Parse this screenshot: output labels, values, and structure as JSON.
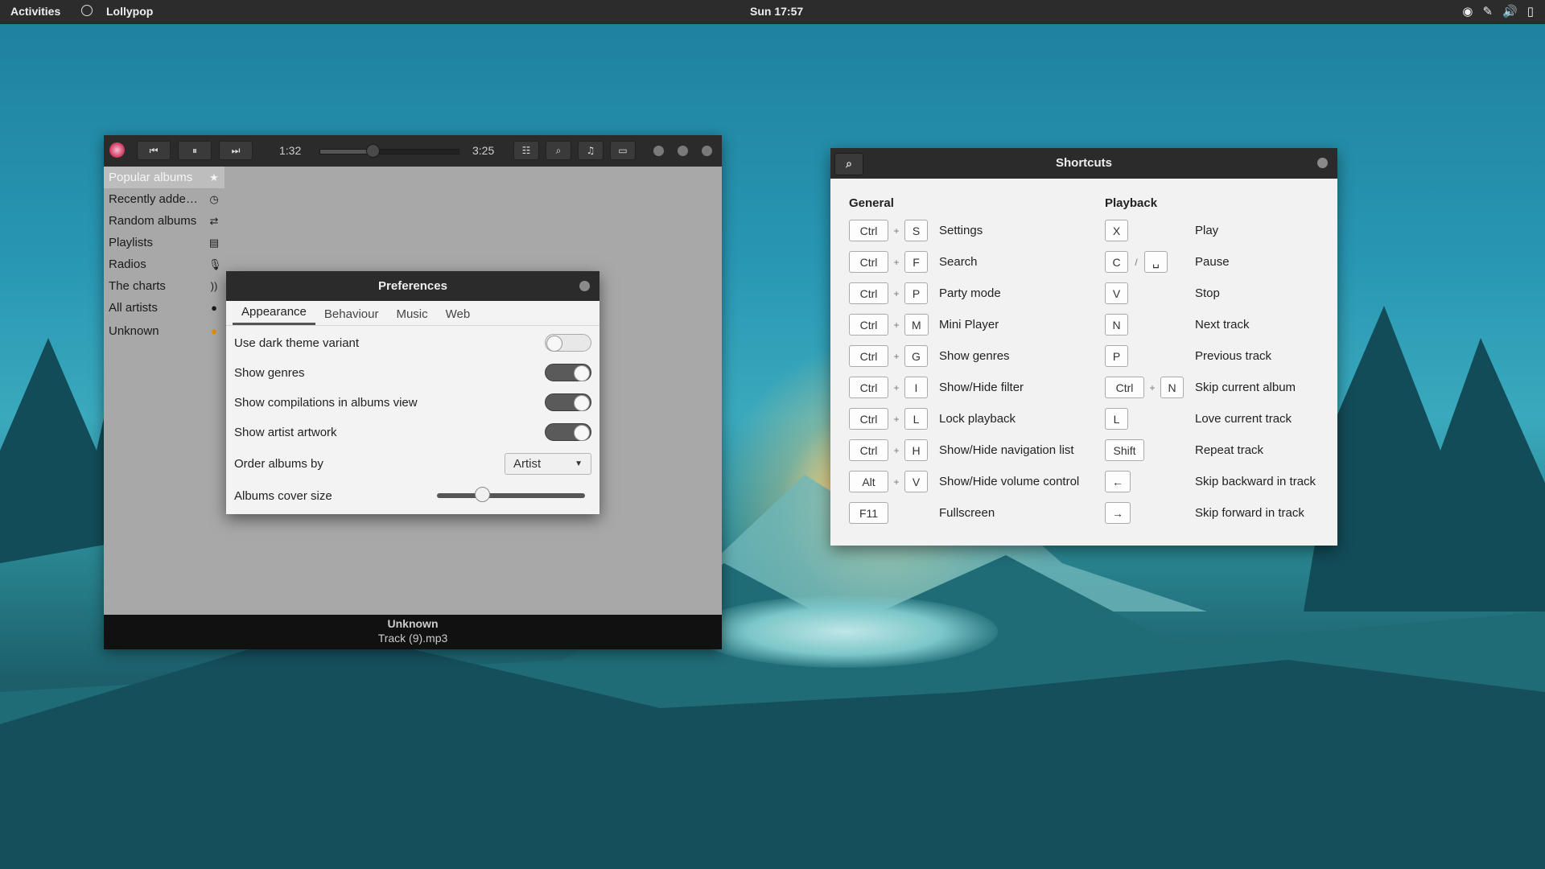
{
  "topbar": {
    "activities": "Activities",
    "app_name": "Lollypop",
    "clock": "Sun 17:57",
    "tray_icons": [
      "network-icon",
      "pen-icon",
      "volume-icon",
      "battery-icon"
    ]
  },
  "player": {
    "elapsed": "1:32",
    "total": "3:25",
    "progress": 0.38,
    "now_playing_artist": "Unknown",
    "now_playing_track": "Track (9).mp3",
    "sidebar": [
      {
        "label": "Popular albums",
        "icon": "star-icon",
        "selected": true
      },
      {
        "label": "Recently adde…",
        "icon": "clock-icon"
      },
      {
        "label": "Random albums",
        "icon": "shuffle-icon"
      },
      {
        "label": "Playlists",
        "icon": "playlist-icon"
      },
      {
        "label": "Radios",
        "icon": "microphone-icon"
      },
      {
        "label": "The charts",
        "icon": "rss-icon"
      },
      {
        "label": "All artists",
        "icon": "person-icon"
      },
      {
        "label": "Unknown",
        "icon": "warning-icon"
      }
    ]
  },
  "preferences": {
    "title": "Preferences",
    "tabs": [
      "Appearance",
      "Behaviour",
      "Music",
      "Web"
    ],
    "rows": [
      {
        "label": "Use dark theme variant",
        "on": false
      },
      {
        "label": "Show genres",
        "on": true
      },
      {
        "label": "Show compilations in albums view",
        "on": true
      },
      {
        "label": "Show artist artwork",
        "on": true
      }
    ],
    "order_label": "Order albums by",
    "order_value": "Artist",
    "cover_label": "Albums cover size",
    "cover_size": 0.3
  },
  "shortcuts": {
    "title": "Shortcuts",
    "general_title": "General",
    "playback_title": "Playback",
    "general": [
      {
        "keys": [
          "Ctrl",
          "S"
        ],
        "desc": "Settings"
      },
      {
        "keys": [
          "Ctrl",
          "F"
        ],
        "desc": "Search"
      },
      {
        "keys": [
          "Ctrl",
          "P"
        ],
        "desc": "Party mode"
      },
      {
        "keys": [
          "Ctrl",
          "M"
        ],
        "desc": "Mini Player"
      },
      {
        "keys": [
          "Ctrl",
          "G"
        ],
        "desc": "Show genres"
      },
      {
        "keys": [
          "Ctrl",
          "I"
        ],
        "desc": "Show/Hide filter"
      },
      {
        "keys": [
          "Ctrl",
          "L"
        ],
        "desc": "Lock playback"
      },
      {
        "keys": [
          "Ctrl",
          "H"
        ],
        "desc": "Show/Hide navigation list"
      },
      {
        "keys": [
          "Alt",
          "V"
        ],
        "desc": "Show/Hide volume control"
      },
      {
        "keys": [
          "F11"
        ],
        "desc": "Fullscreen"
      }
    ],
    "playback": [
      {
        "keys": [
          "X"
        ],
        "desc": "Play"
      },
      {
        "keys": [
          "C",
          "␣"
        ],
        "sep": "/",
        "desc": "Pause"
      },
      {
        "keys": [
          "V"
        ],
        "desc": "Stop"
      },
      {
        "keys": [
          "N"
        ],
        "desc": "Next track"
      },
      {
        "keys": [
          "P"
        ],
        "desc": "Previous track"
      },
      {
        "keys": [
          "Ctrl",
          "N"
        ],
        "desc": "Skip current album"
      },
      {
        "keys": [
          "L"
        ],
        "desc": "Love current track"
      },
      {
        "keys": [
          "Shift"
        ],
        "desc": "Repeat track"
      },
      {
        "keys": [
          "←"
        ],
        "desc": "Skip backward in track"
      },
      {
        "keys": [
          "→"
        ],
        "desc": "Skip forward in track"
      }
    ]
  }
}
